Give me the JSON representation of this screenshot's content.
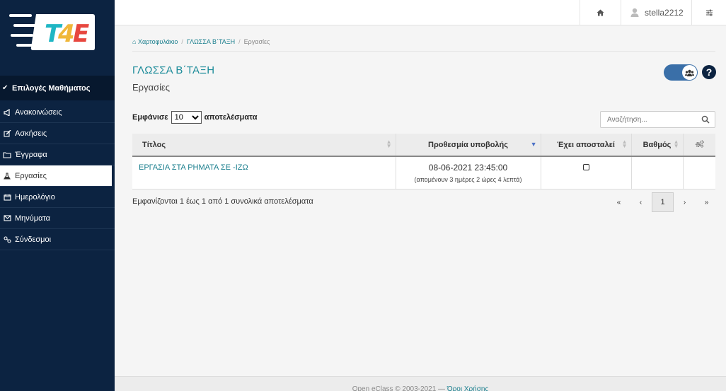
{
  "logo": {
    "text": "T4E"
  },
  "sidebar": {
    "course_options": "Επιλογές Μαθήματος",
    "items": [
      {
        "label": "Ανακοινώσεις",
        "icon": "megaphone-icon"
      },
      {
        "label": "Ασκήσεις",
        "icon": "edit-icon"
      },
      {
        "label": "Έγγραφα",
        "icon": "folder-icon"
      },
      {
        "label": "Εργασίες",
        "icon": "flask-icon",
        "active": true
      },
      {
        "label": "Ημερολόγιο",
        "icon": "calendar-icon"
      },
      {
        "label": "Μηνύματα",
        "icon": "envelope-icon"
      },
      {
        "label": "Σύνδεσμοι",
        "icon": "link-icon"
      }
    ]
  },
  "topbar": {
    "username": "stella2212"
  },
  "breadcrumb": {
    "items": [
      "Χαρτοφυλάκιο",
      "ΓΛΩΣΣΑ Β΄ΤΑΞΗ",
      "Εργασίες"
    ]
  },
  "page": {
    "title": "ΓΛΩΣΣΑ Β΄ΤΑΞΗ",
    "subtitle": "Εργασίες"
  },
  "table_controls": {
    "show_prefix": "Εμφάνισε",
    "show_value": "10",
    "show_suffix": "αποτελέσματα",
    "search_placeholder": "Αναζήτηση..."
  },
  "table": {
    "headers": [
      "Τίτλος",
      "Προθεσμία υποβολής",
      "Έχει αποσταλεί",
      "Βαθμός"
    ],
    "rows": [
      {
        "title": "ΕΡΓΑΣΙΑ ΣΤΑ ΡΗΜΑΤΑ ΣΕ -ΙΖΩ",
        "deadline": "08-06-2021 23:45:00",
        "remaining": "(απομένουν 3 ημέρες 2 ώρες 4 λεπτά)",
        "submitted": false,
        "grade": ""
      }
    ]
  },
  "info_text": "Εμφανίζονται 1 έως 1 από 1 συνολικά αποτελέσματα",
  "pager": {
    "first": "«",
    "prev": "‹",
    "current": "1",
    "next": "›",
    "last": "»"
  },
  "footer": {
    "text": "Open eClass © 2003-2021 — ",
    "link": "Όροι Χρήσης"
  },
  "colors": {
    "sidebar": "#0c2341",
    "accent": "#1b8b99",
    "toggle": "#3a6fa8"
  }
}
